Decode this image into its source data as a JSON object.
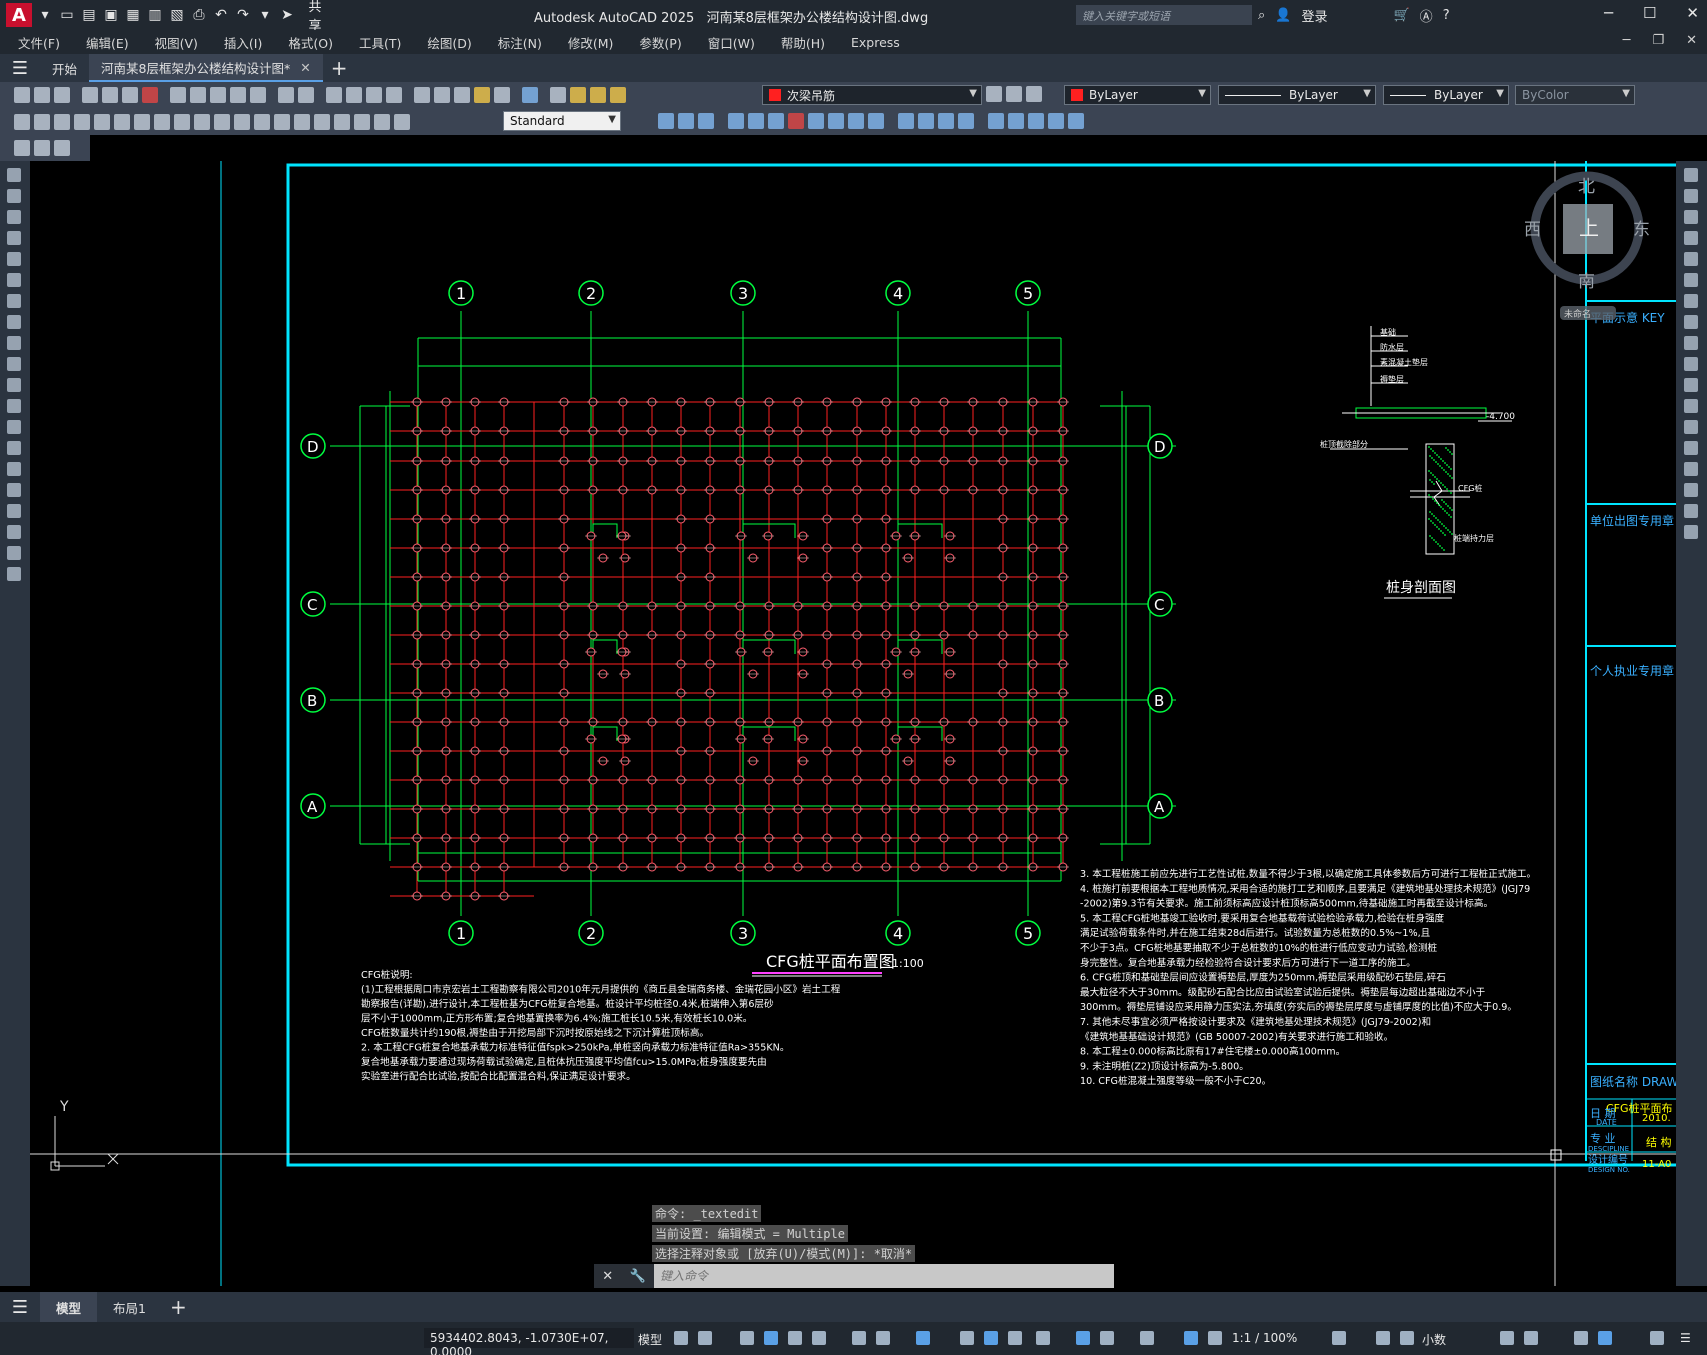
{
  "app": {
    "logo_letter": "A",
    "title": "Autodesk AutoCAD 2025",
    "document": "河南某8层框架办公楼结构设计图.dwg",
    "share_label": "共享",
    "search_placeholder": "键入关键字或短语",
    "login_label": "登录"
  },
  "menu": [
    "文件(F)",
    "编辑(E)",
    "视图(V)",
    "插入(I)",
    "格式(O)",
    "工具(T)",
    "绘图(D)",
    "标注(N)",
    "修改(M)",
    "参数(P)",
    "窗口(W)",
    "帮助(H)",
    "Express"
  ],
  "tabs": {
    "start": "开始",
    "doc": "河南某8层框架办公楼结构设计图*"
  },
  "toolbar": {
    "layer_name": "次梁吊筋",
    "layer_color": "#ff2020",
    "color_value": "ByLayer",
    "linetype_value": "ByLayer",
    "lineweight_value": "ByLayer",
    "plotstyle_value": "ByColor",
    "text_style": "Standard"
  },
  "drawing": {
    "grid_cols": [
      "1",
      "2",
      "3",
      "4",
      "5"
    ],
    "grid_rows": [
      "D",
      "C",
      "B",
      "A"
    ],
    "title": "CFG桩平面布置图",
    "scale": "1:100",
    "section_title": "桩身剖面图",
    "section_labels": [
      "基础",
      "防水层",
      "素混凝土垫层",
      "褥垫层"
    ],
    "section_elev": "-4.700",
    "section_cut": "桩顶截除部分",
    "cfg_label": "CFG桩",
    "pile_base": "桩端持力层",
    "notes_left": [
      "CFG桩说明:",
      "(1)工程根据周口市京宏岩土工程勘察有限公司2010年元月提供的《商丘县金瑞商务楼、金瑞花园小区》岩土工程",
      "勘察报告(详勘),进行设计,本工程桩基为CFG桩复合地基。桩设计平均桩径0.4米,桩端伸入第6层砂",
      "层不小于1000mm,正方形布置;复合地基置换率为6.4%;施工桩长10.5米,有效桩长10.0米。",
      "CFG桩数量共计约190根,褥垫由于开挖局部下沉时按原始线之下沉计算桩顶标高。",
      "2. 本工程CFG桩复合地基承载力标准特征值fspk>250kPa,单桩竖向承载力标准特征值Ra>355KN。",
      "复合地基承载力要通过现场荷载试验确定,且桩体抗压强度平均值fcu>15.0MPa;桩身强度要先由",
      "实验室进行配合比试验,按配合比配置混合料,保证满足设计要求。"
    ],
    "notes_right": [
      "3. 本工程桩施工前应先进行工艺性试桩,数量不得少于3根,以确定施工具体参数后方可进行工程桩正式施工。",
      "4. 桩施打前要根据本工程地质情况,采用合适的施打工艺和顺序,且要满足《建筑地基处理技术规范》(JGJ79",
      "-2002)第9.3节有关要求。施工前须标高应设计桩顶标高500mm,待基础施工时再截至设计标高。",
      "5. 本工程CFG桩地基竣工验收时,要采用复合地基载荷试验检验承载力,检验在桩身强度",
      "满足试验荷载条件时,并在施工结束28d后进行。试验数量为总桩数的0.5%~1%,且",
      "不少于3点。CFG桩地基要抽取不少于总桩数的10%的桩进行低应变动力试验,检测桩",
      "身完整性。复合地基承载力经检验符合设计要求后方可进行下一道工序的施工。",
      "6. CFG桩顶和基础垫层间应设置褥垫层,厚度为250mm,褥垫层采用级配砂石垫层,碎石",
      "最大粒径不大于30mm。级配砂石配合比应由试验室试验后提供。褥垫层每边超出基础边不小于",
      "300mm。褥垫层铺设应采用静力压实法,夯填度(夯实后的褥垫层厚度与虚铺厚度的比值)不应大于0.9。",
      "7. 其他未尽事宜必须严格按设计要求及《建筑地基处理技术规范》(JGJ79-2002)和",
      "《建筑地基基础设计规范》(GB 50007-2002)有关要求进行施工和验收。",
      "8. 本工程±0.000标高比原有17#住宅楼±0.000高100mm。",
      "9. 未注明桩(Z2)顶设计标高为-5.800。",
      "10. CFG桩混凝土强度等级一般不小于C20。"
    ],
    "right_panel": {
      "key_plan": "平面示意 KEY",
      "unit_stamp": "单位出图专用章",
      "personal_stamp": "个人执业专用章",
      "drawing_name_label": "图纸名称 DRAW",
      "drawing_name": "CFG桩平面布",
      "date_label": "日 期",
      "date_en": "DATE",
      "date_value": "2010.",
      "discipline_label": "专 业",
      "discipline_en": "DESCIPLINE",
      "discipline_value": "结 构",
      "number_label": "设计编号",
      "number_en": "DESIGN NO.",
      "number_value": "11-A0"
    },
    "viewcube": {
      "north": "北",
      "south": "南",
      "east": "东",
      "west": "西",
      "top": "上",
      "wcs": "未命名"
    },
    "ucs": {
      "y": "Y",
      "x": "X"
    }
  },
  "command": {
    "history": [
      "命令: _textedit",
      "当前设置: 编辑模式 = Multiple",
      "选择注释对象或 [放弃(U)/模式(M)]: *取消*"
    ],
    "placeholder": "键入命令"
  },
  "layouts": [
    "模型",
    "布局1"
  ],
  "status": {
    "coords": "5934402.8043, -1.0730E+07, 0.0000",
    "model": "模型",
    "scale": "1:1 / 100%",
    "units": "小数"
  }
}
